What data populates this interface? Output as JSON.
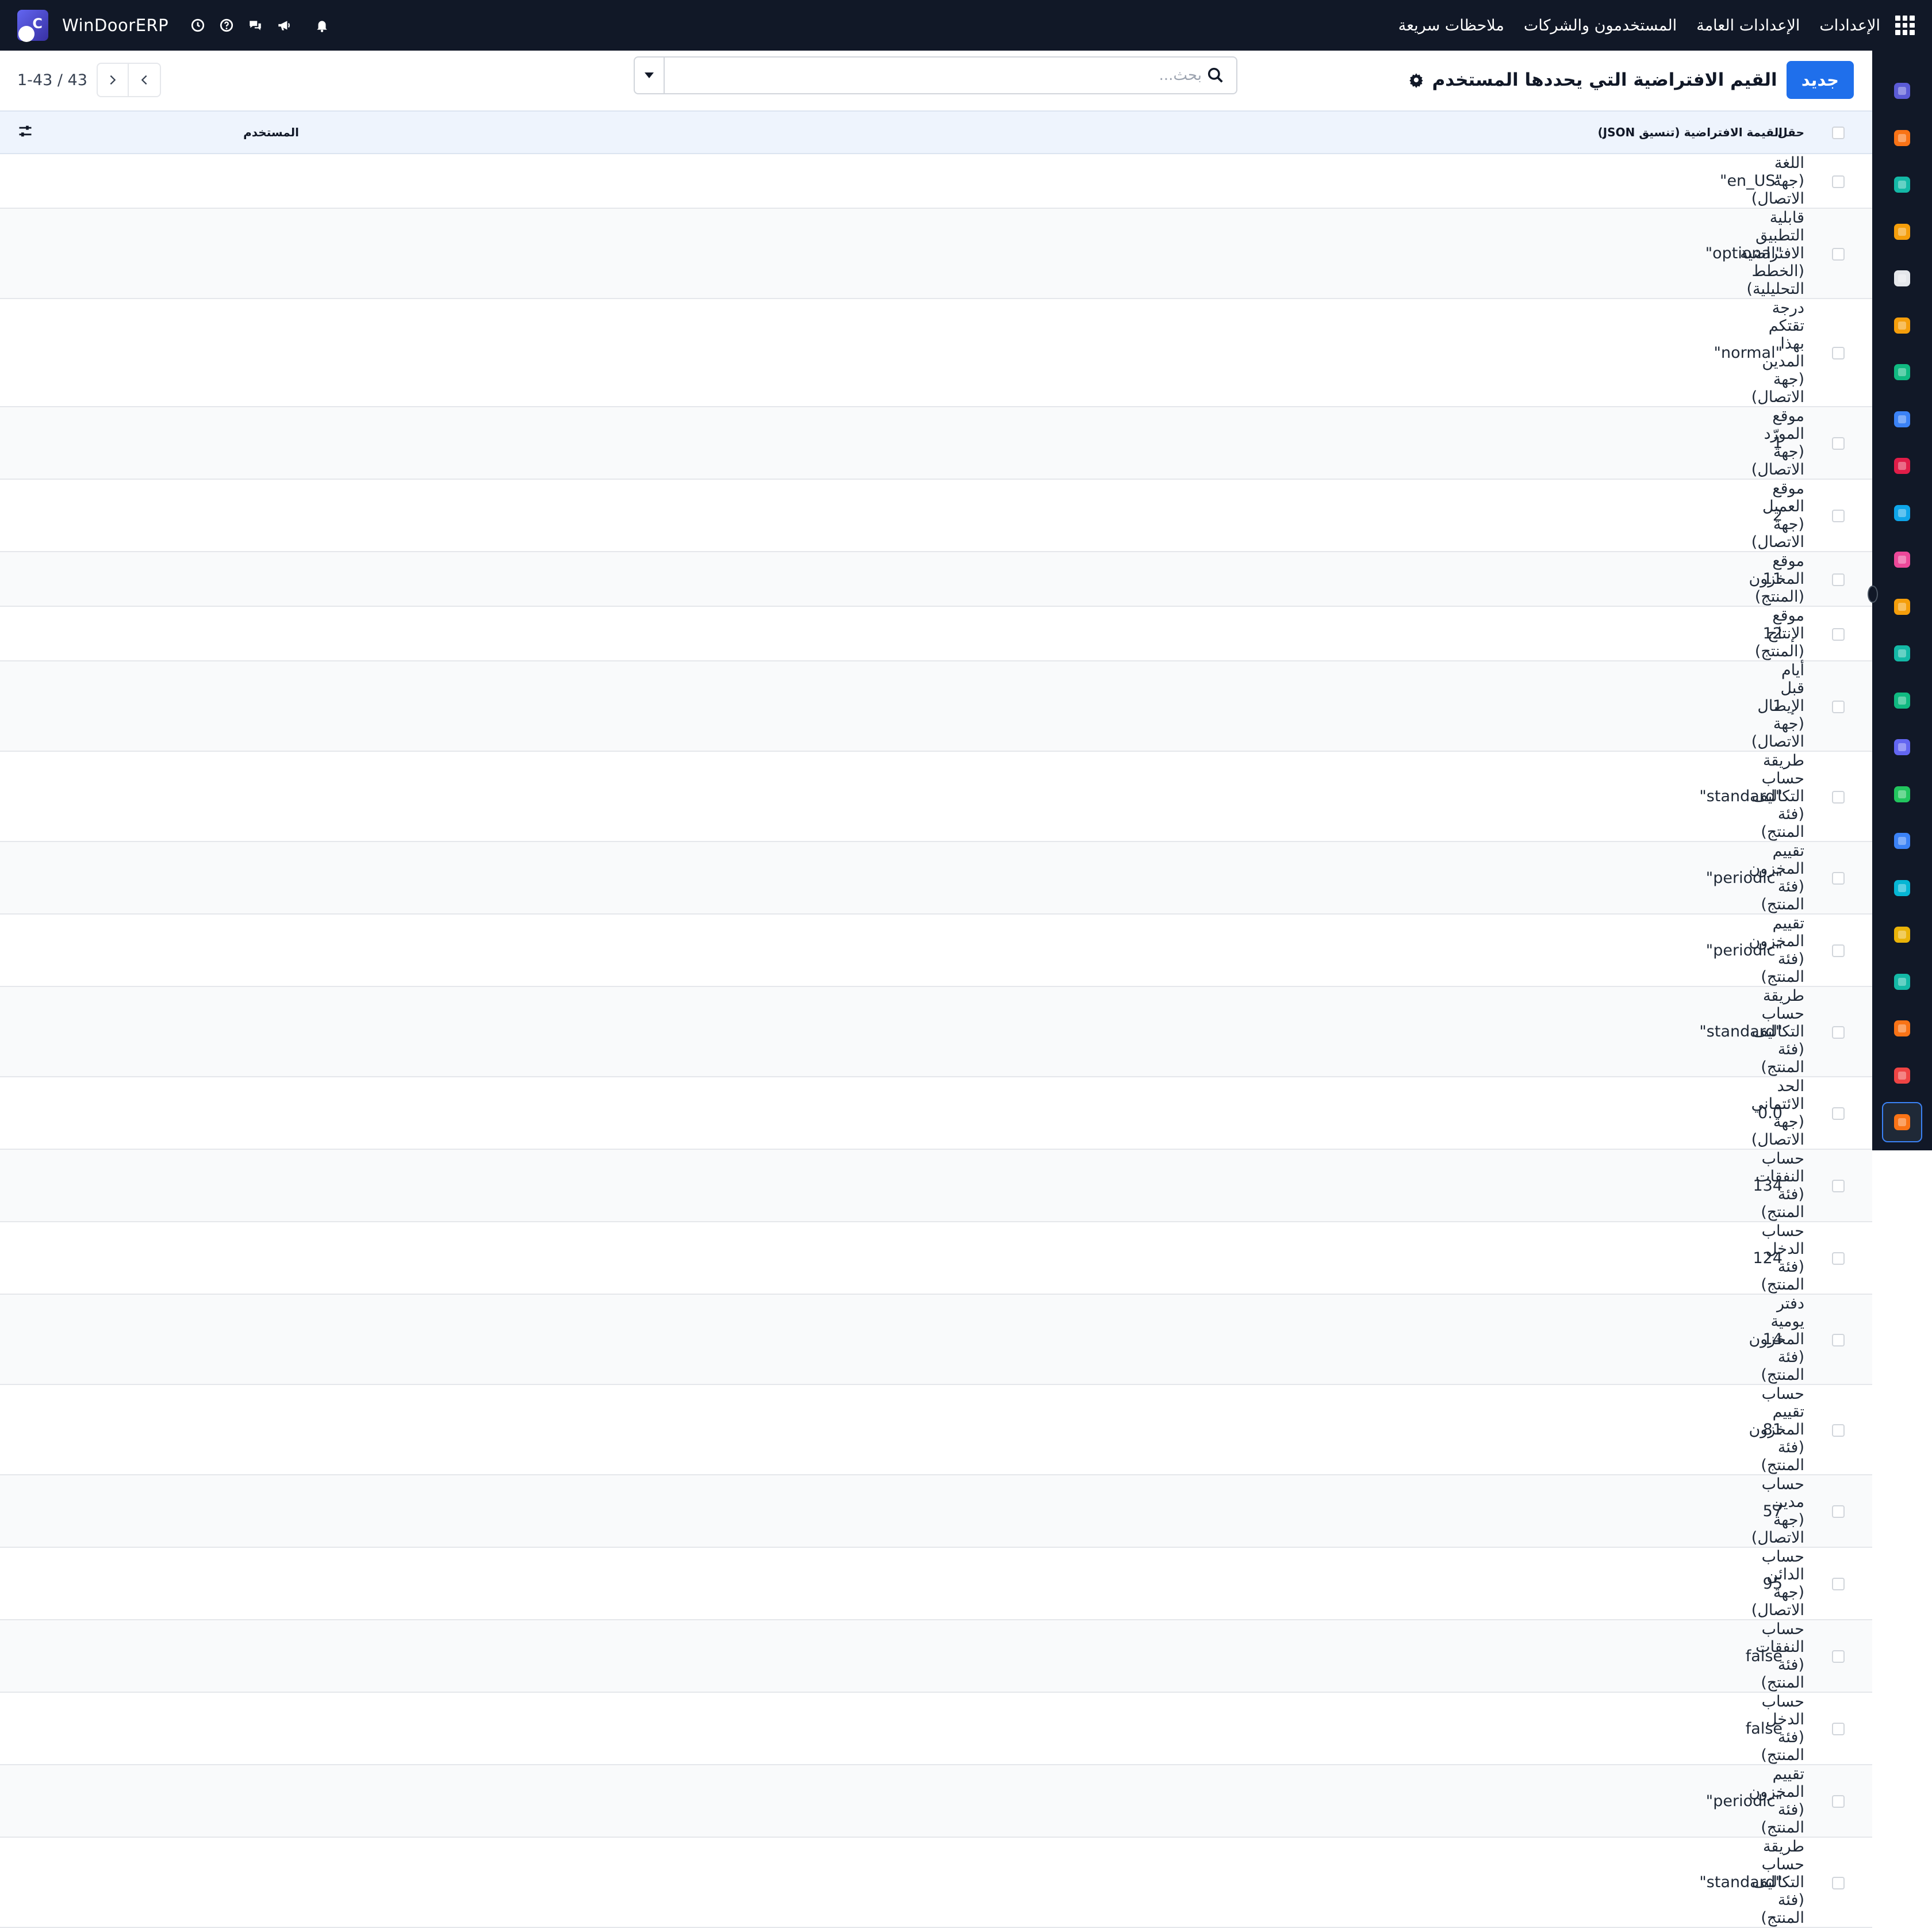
{
  "navbar": {
    "brand": "WinDoorERP",
    "menu": [
      "الإعدادات",
      "الإعدادات العامة",
      "المستخدمون والشركات",
      "ملاحظات سريعة"
    ]
  },
  "control_panel": {
    "new_button": "جديد",
    "title": "القيم الافتراضية التي يحددها المستخدم",
    "search_placeholder": "بحث...",
    "pager": "1-43 / 43"
  },
  "table": {
    "headers": {
      "field": "حقل",
      "json": "القيمة الافتراضية (تنسيق JSON)",
      "user": "المستخدم"
    },
    "rows": [
      {
        "field": "اللغة (جهة الاتصال)",
        "json": "\"en_US\"",
        "user": ""
      },
      {
        "field": "قابلية التطبيق الافتراضية (الخطط التحليلية)",
        "json": "\"optional\"",
        "user": ""
      },
      {
        "field": "درجة تقتكم بهذا المدين (جهة الاتصال)",
        "json": "\"normal\"",
        "user": ""
      },
      {
        "field": "موقع المورّد (جهة الاتصال)",
        "json": "1",
        "user": ""
      },
      {
        "field": "موقع العميل (جهة الاتصال)",
        "json": "2",
        "user": ""
      },
      {
        "field": "موقع المخزون (المنتج)",
        "json": "11",
        "user": ""
      },
      {
        "field": "موقع الإنتاج (المنتج)",
        "json": "12",
        "user": ""
      },
      {
        "field": "أيام قبل الإيصال (جهة الاتصال)",
        "json": "1",
        "user": ""
      },
      {
        "field": "طريقة حساب التكاليف (فئة المنتج)",
        "json": "\"standard\"",
        "user": ""
      },
      {
        "field": "تقييم المخزون (فئة المنتج)",
        "json": "\"periodic\"",
        "user": ""
      },
      {
        "field": "تقييم المخزون (فئة المنتج)",
        "json": "\"periodic\"",
        "user": ""
      },
      {
        "field": "طريقة حساب التكاليف (فئة المنتج)",
        "json": "\"standard\"",
        "user": ""
      },
      {
        "field": "الحد الائتماني (جهة الاتصال)",
        "json": "0.0",
        "user": ""
      },
      {
        "field": "حساب النفقات (فئة المنتج)",
        "json": "134",
        "user": ""
      },
      {
        "field": "حساب الدخل (فئة المنتج)",
        "json": "124",
        "user": ""
      },
      {
        "field": "دفتر يومية المخزون (فئة المنتج)",
        "json": "14",
        "user": ""
      },
      {
        "field": "حساب تقييم المخزون (فئة المنتج)",
        "json": "81",
        "user": ""
      },
      {
        "field": "حساب مدين (جهة الاتصال)",
        "json": "57",
        "user": ""
      },
      {
        "field": "حساب الدائن (جهة الاتصال)",
        "json": "95",
        "user": ""
      },
      {
        "field": "حساب النفقات (فئة المنتج)",
        "json": "false",
        "user": ""
      },
      {
        "field": "حساب الدخل (فئة المنتج)",
        "json": "false",
        "user": ""
      },
      {
        "field": "تقييم المخزون (فئة المنتج)",
        "json": "\"periodic\"",
        "user": ""
      },
      {
        "field": "طريقة حساب التكاليف (فئة المنتج)",
        "json": "\"standard\"",
        "user": ""
      }
    ]
  },
  "app_rail": [
    {
      "name": "mail-app-icon",
      "color": "#5b5bd6"
    },
    {
      "name": "discuss-app-icon",
      "color": "#f97316"
    },
    {
      "name": "project-app-icon",
      "color": "#14b8a6"
    },
    {
      "name": "dashboard-app-icon",
      "color": "#f59e0b"
    },
    {
      "name": "inventory-box-icon",
      "color": "#e5e7eb"
    },
    {
      "name": "contacts-app-icon",
      "color": "#f59e0b"
    },
    {
      "name": "tasks-check-icon",
      "color": "#10b981"
    },
    {
      "name": "knowledge-app-icon",
      "color": "#3b82f6"
    },
    {
      "name": "package-app-icon",
      "color": "#e11d48"
    },
    {
      "name": "invoicing-app-icon",
      "color": "#0ea5e9"
    },
    {
      "name": "employees-app-icon",
      "color": "#ec4899"
    },
    {
      "name": "calendar-app-icon",
      "color": "#f59e0b"
    },
    {
      "name": "sign-app-icon",
      "color": "#14b8a6"
    },
    {
      "name": "id-card-app-icon",
      "color": "#10b981"
    },
    {
      "name": "widgets-app-icon",
      "color": "#6366f1"
    },
    {
      "name": "whatsapp-app-icon",
      "color": "#22c55e"
    },
    {
      "name": "time-off-app-icon",
      "color": "#3b82f6"
    },
    {
      "name": "website-app-icon",
      "color": "#06b6d4"
    },
    {
      "name": "telegram-app-icon",
      "color": "#eab308"
    },
    {
      "name": "spreadsheet-app-icon",
      "color": "#14b8a6"
    },
    {
      "name": "studio-app-icon",
      "color": "#f97316"
    },
    {
      "name": "pie-app-icon",
      "color": "#ef4444"
    },
    {
      "name": "settings-app-icon",
      "color": "#f97316"
    }
  ],
  "colors": {
    "navbar_bg": "#111827",
    "primary": "#1f6feb",
    "header_row_bg": "#eef4fd"
  }
}
